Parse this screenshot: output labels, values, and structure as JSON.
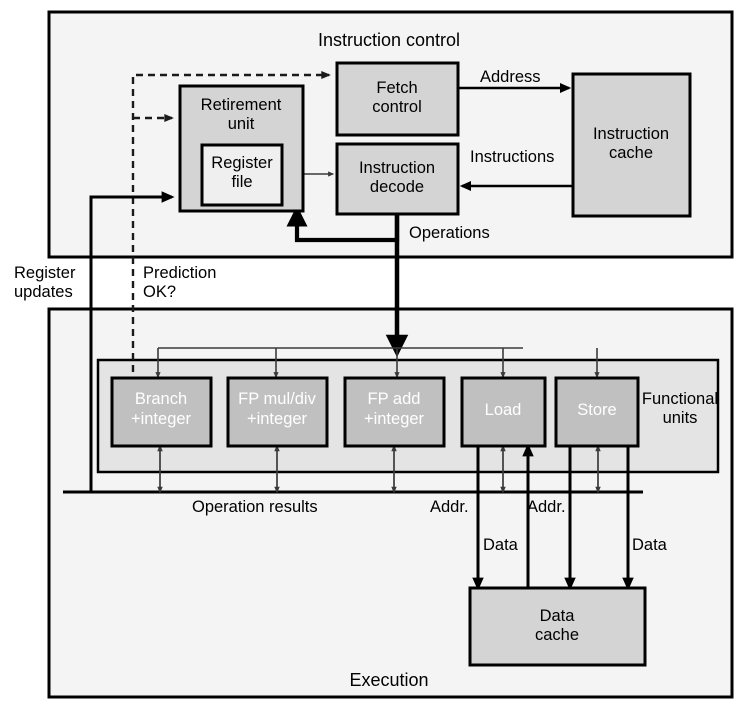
{
  "diagram": {
    "title": "Out-of-order processor microarchitecture block diagram",
    "colors": {
      "panel_fill": "#f4f4f4",
      "block_fill": "#d4d4d4",
      "functional_panel_fill": "#e4e4e4",
      "functional_unit_fill": "#c0c0c0",
      "register_file_fill": "#efefef",
      "stroke": "#000000",
      "thin_stroke": "#3a3a3a",
      "text": "#000000",
      "unit_text": "#ffffff"
    },
    "sections": [
      {
        "id": "instruction-control",
        "label": "Instruction control"
      },
      {
        "id": "execution",
        "label": "Execution"
      }
    ],
    "blocks": [
      {
        "id": "retirement-unit",
        "label": "Retirement\nunit"
      },
      {
        "id": "register-file",
        "label": "Register\nfile"
      },
      {
        "id": "fetch-control",
        "label": "Fetch\ncontrol"
      },
      {
        "id": "instruction-decode",
        "label": "Instruction\ndecode"
      },
      {
        "id": "instruction-cache",
        "label": "Instruction\ncache"
      },
      {
        "id": "data-cache",
        "label": "Data\ncache"
      }
    ],
    "functional_units": [
      {
        "id": "branch-integer",
        "line1": "Branch",
        "line2": "+integer"
      },
      {
        "id": "fp-muldiv-integer",
        "line1": "FP mul/div",
        "line2": "+integer"
      },
      {
        "id": "fp-add-integer",
        "line1": "FP add",
        "line2": "+integer"
      },
      {
        "id": "load",
        "line1": "Load",
        "line2": ""
      },
      {
        "id": "store",
        "line1": "Store",
        "line2": ""
      }
    ],
    "functional_units_label": "Functional\nunits",
    "edge_labels": [
      {
        "id": "address",
        "text": "Address"
      },
      {
        "id": "instructions",
        "text": "Instructions"
      },
      {
        "id": "operations",
        "text": "Operations"
      },
      {
        "id": "register-updates",
        "text": "Register\nupdates"
      },
      {
        "id": "prediction-ok",
        "text": "Prediction\nOK?"
      },
      {
        "id": "operation-results",
        "text": "Operation results"
      },
      {
        "id": "addr-load",
        "text": "Addr."
      },
      {
        "id": "data-load",
        "text": "Data"
      },
      {
        "id": "addr-store",
        "text": "Addr."
      },
      {
        "id": "data-store",
        "text": "Data"
      }
    ]
  }
}
